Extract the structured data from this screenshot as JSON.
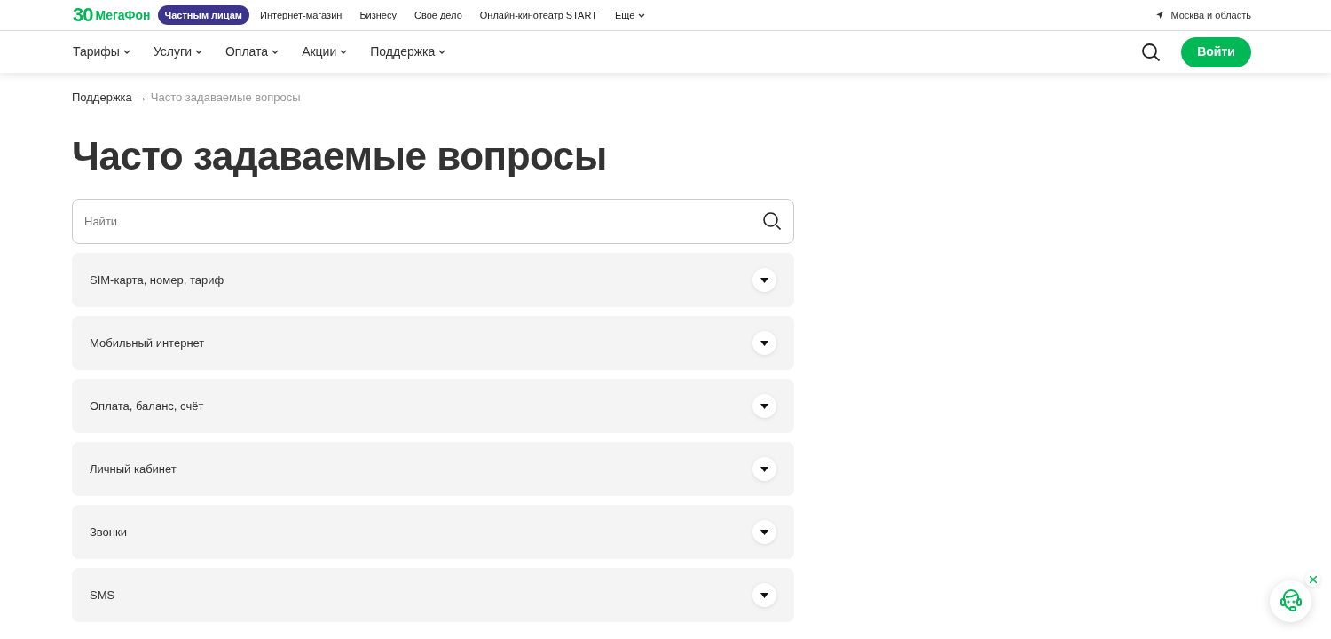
{
  "logo": {
    "number": "30",
    "name": "МегаФон"
  },
  "segments": [
    {
      "label": "Частным лицам",
      "selected": true
    },
    {
      "label": "Интернет-магазин",
      "selected": false
    },
    {
      "label": "Бизнесу",
      "selected": false
    },
    {
      "label": "Своё дело",
      "selected": false
    },
    {
      "label": "Онлайн-кинотеатр START",
      "selected": false
    },
    {
      "label": "Ещё",
      "selected": false,
      "kind": "dropdown"
    }
  ],
  "region": "Москва и область",
  "menu": [
    "Тарифы",
    "Услуги",
    "Оплата",
    "Акции",
    "Поддержка"
  ],
  "login_button": "Войти",
  "breadcrumbs": {
    "parent": "Поддержка",
    "separator": "→",
    "current": "Часто задаваемые вопросы"
  },
  "title": "Часто задаваемые вопросы",
  "search": {
    "placeholder": "Найти"
  },
  "faq": [
    {
      "label": "SIM-карта, номер, тариф",
      "expanded": false
    },
    {
      "label": "Мобильный интернет",
      "expanded": false
    },
    {
      "label": "Оплата, баланс, счёт",
      "expanded": false
    },
    {
      "label": "Личный кабинет",
      "expanded": false
    },
    {
      "label": "Звонки",
      "expanded": false
    },
    {
      "label": "SMS",
      "expanded": false
    }
  ]
}
